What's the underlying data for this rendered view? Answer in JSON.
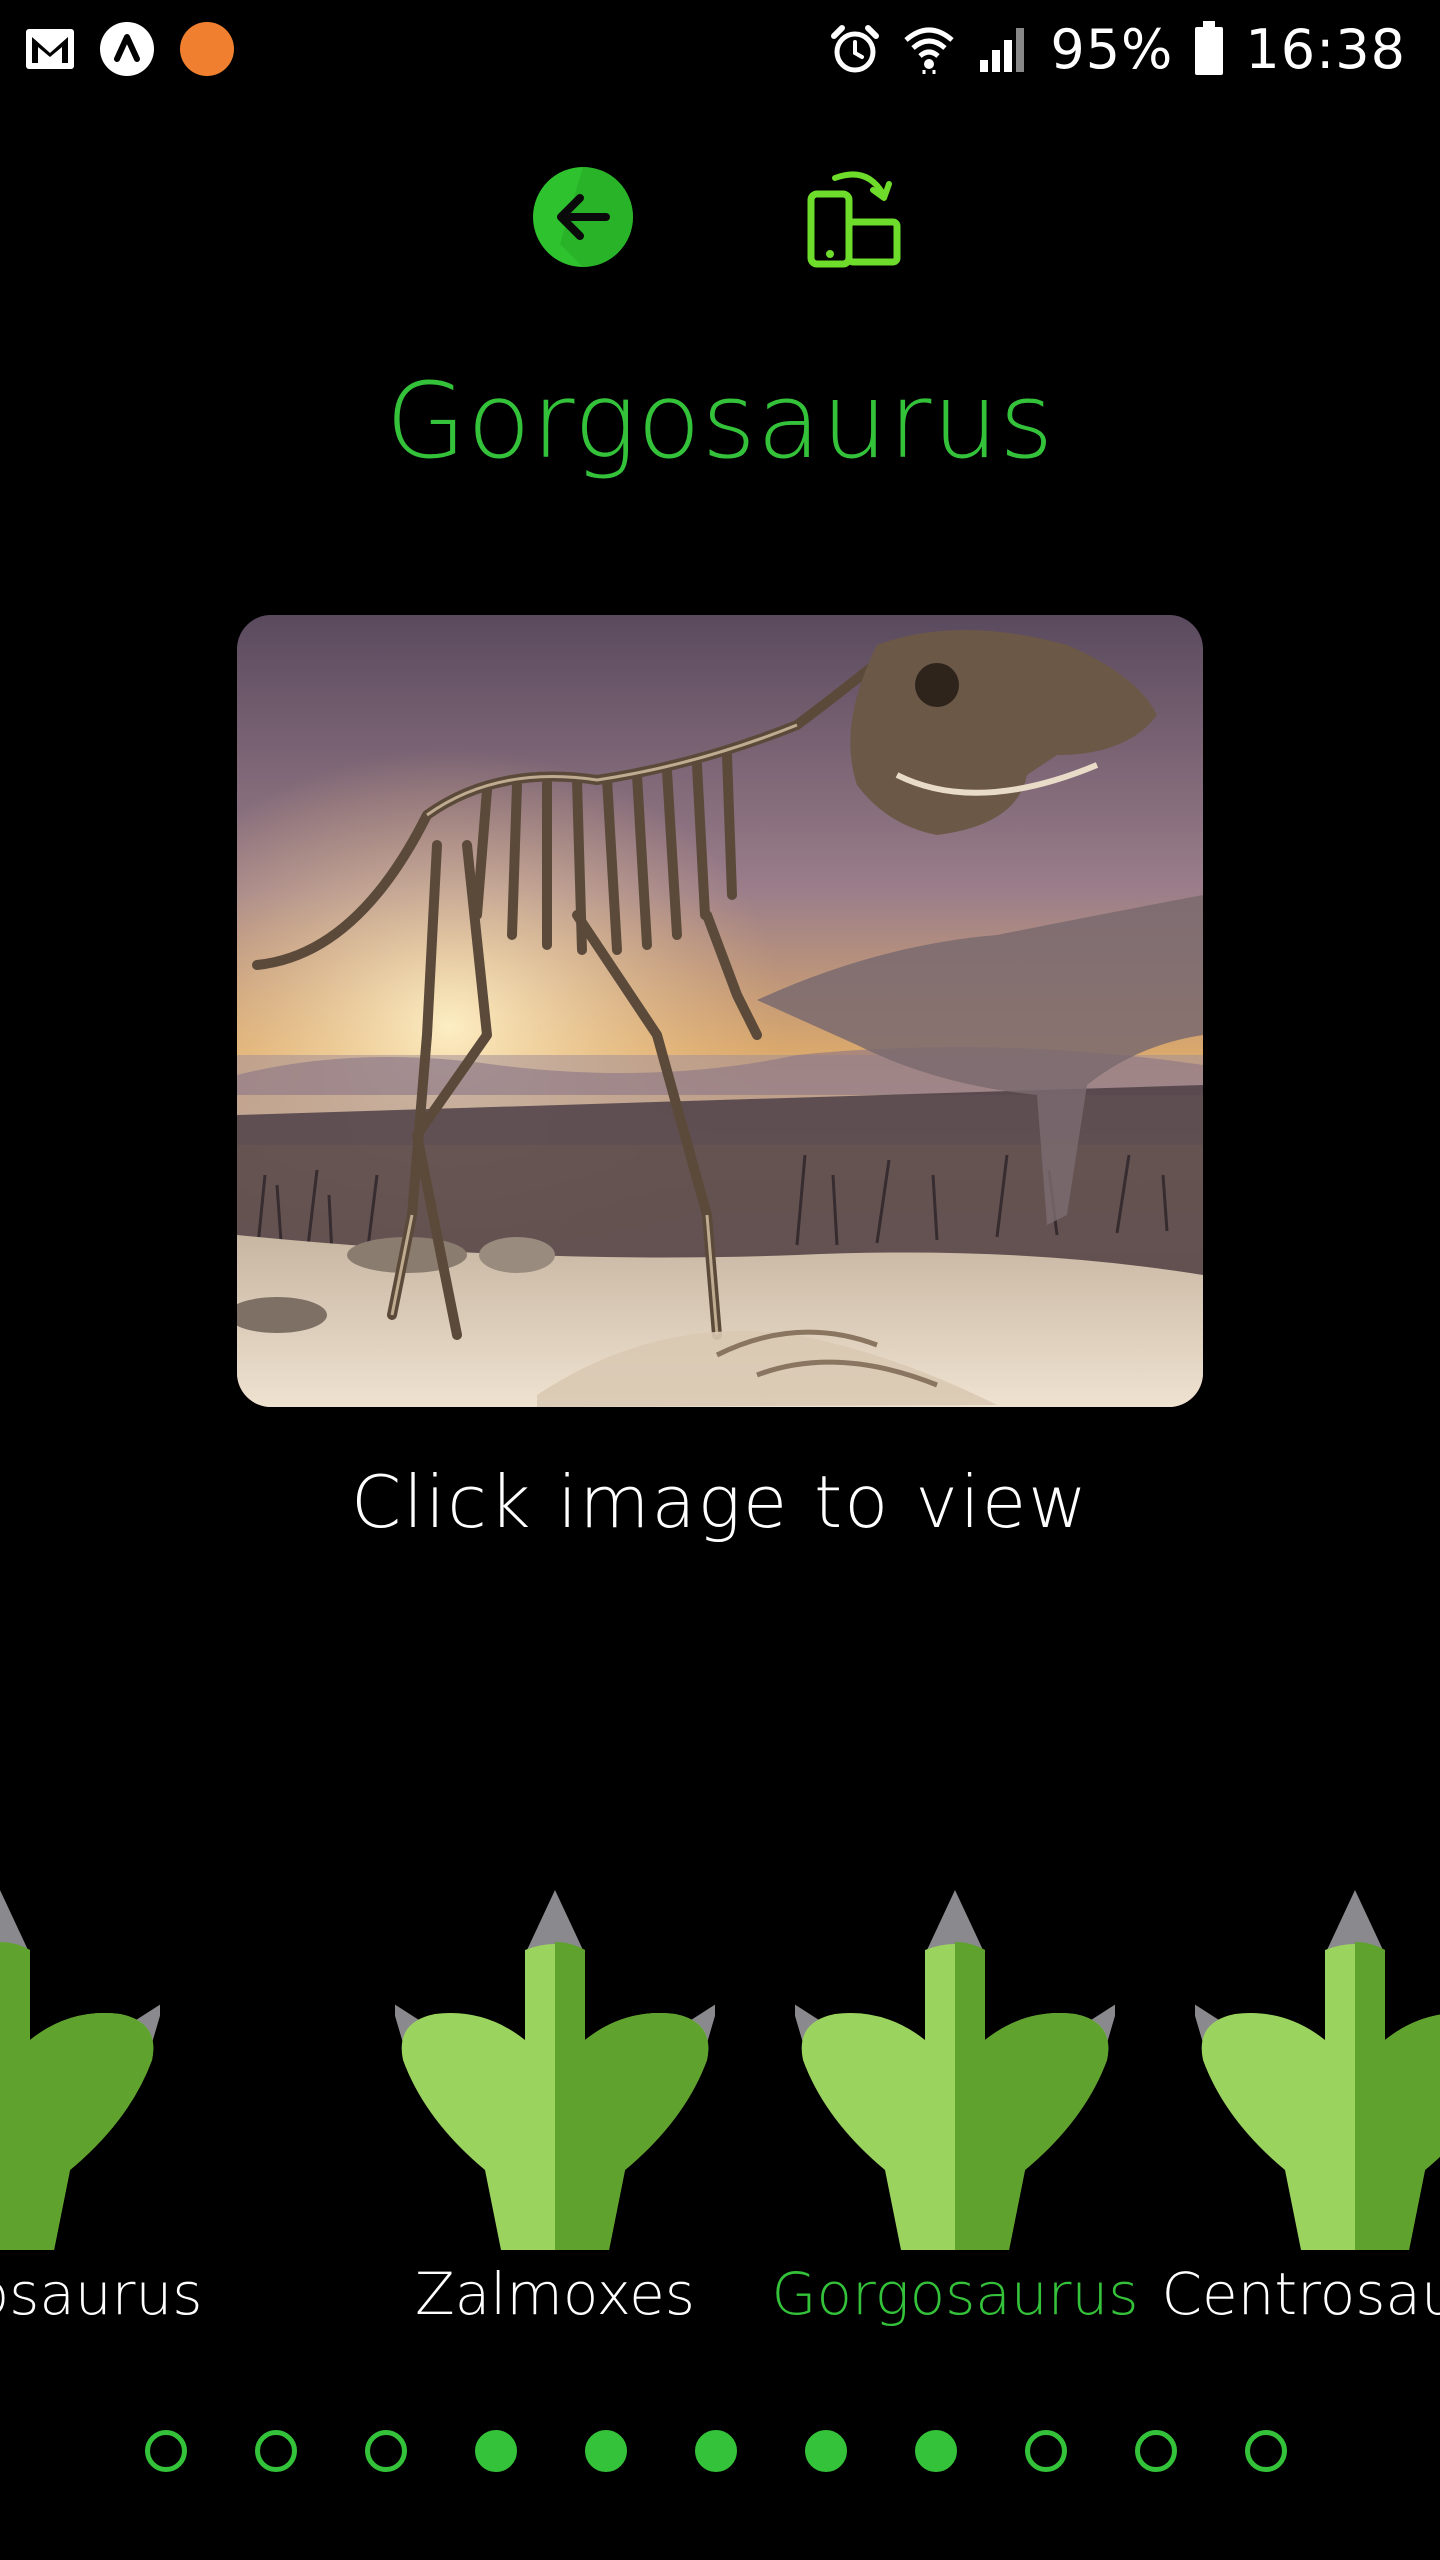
{
  "status_bar": {
    "battery_percent": "95%",
    "time": "16:38",
    "icons": [
      "gmail-icon",
      "app-icon",
      "notification-dot-icon",
      "alarm-icon",
      "wifi-icon",
      "signal-icon",
      "battery-icon"
    ]
  },
  "toolbar": {
    "back_icon": "arrow-left-icon",
    "rotate_icon": "screen-rotation-icon"
  },
  "dinosaur": {
    "name": "Gorgosaurus",
    "image_description": "skeleton-photo",
    "hint": "Click image to view"
  },
  "carousel": {
    "items": [
      {
        "label": "Alachiosaurus",
        "icon": "dinosaur-foot-icon",
        "active": false
      },
      {
        "label": "Zalmoxes",
        "icon": "dinosaur-foot-icon",
        "active": false
      },
      {
        "label": "Gorgosaurus",
        "icon": "dinosaur-foot-icon",
        "active": true
      },
      {
        "label": "Centrosaurus",
        "icon": "dinosaur-foot-icon",
        "active": false
      }
    ]
  },
  "pagination": {
    "dots": [
      false,
      false,
      false,
      true,
      true,
      true,
      true,
      true,
      false,
      false,
      false
    ]
  },
  "colors": {
    "accent": "#34c23a",
    "background": "#000000",
    "text": "#ffffff",
    "foot_light": "#9ad45e",
    "foot_dark": "#5fa22e",
    "claw": "#8a8a8e"
  }
}
